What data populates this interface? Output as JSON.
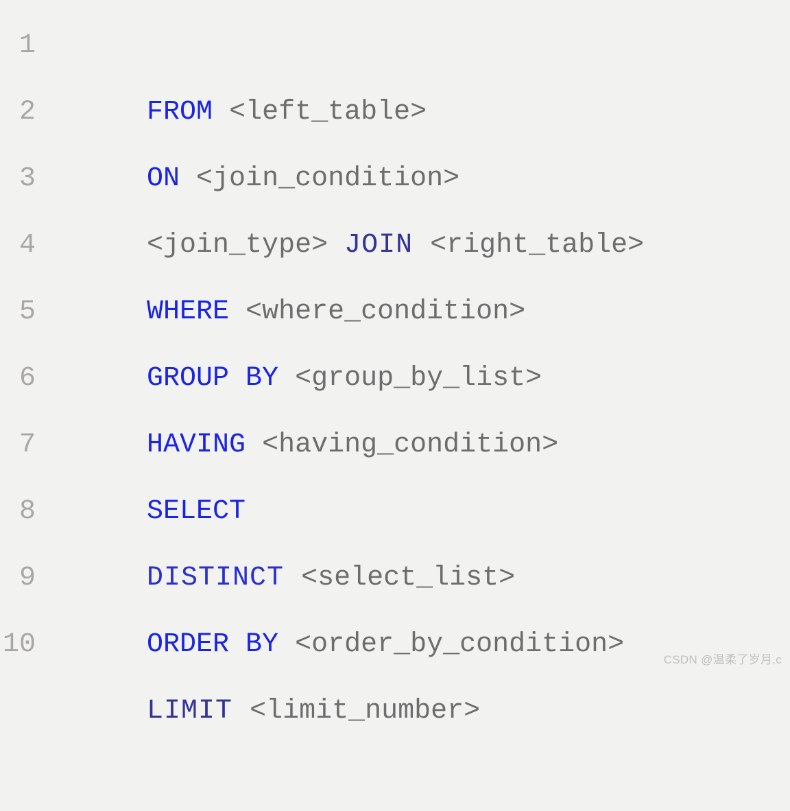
{
  "lines": [
    {
      "num": "1",
      "tokens": [
        {
          "t": "FROM ",
          "c": "keyword"
        },
        {
          "t": "<left_table>",
          "c": "placeholder"
        }
      ]
    },
    {
      "num": "2",
      "tokens": [
        {
          "t": "ON ",
          "c": "keyword"
        },
        {
          "t": "<join_condition>",
          "c": "placeholder"
        }
      ]
    },
    {
      "num": "3",
      "tokens": [
        {
          "t": "<join_type> ",
          "c": "placeholder"
        },
        {
          "t": "JOIN ",
          "c": "keyword2"
        },
        {
          "t": "<right_table>",
          "c": "placeholder"
        }
      ]
    },
    {
      "num": "4",
      "tokens": [
        {
          "t": "WHERE ",
          "c": "keyword"
        },
        {
          "t": "<where_condition>",
          "c": "placeholder"
        }
      ]
    },
    {
      "num": "5",
      "tokens": [
        {
          "t": "GROUP BY ",
          "c": "keyword"
        },
        {
          "t": "<group_by_list>",
          "c": "placeholder"
        }
      ]
    },
    {
      "num": "6",
      "tokens": [
        {
          "t": "HAVING ",
          "c": "keyword"
        },
        {
          "t": "<having_condition>",
          "c": "placeholder"
        }
      ]
    },
    {
      "num": "7",
      "tokens": [
        {
          "t": "SELECT",
          "c": "keyword"
        }
      ]
    },
    {
      "num": "8",
      "tokens": [
        {
          "t": "DISTINCT ",
          "c": "distinct-kw"
        },
        {
          "t": "<select_list>",
          "c": "placeholder"
        }
      ]
    },
    {
      "num": "9",
      "tokens": [
        {
          "t": "ORDER BY ",
          "c": "keyword"
        },
        {
          "t": "<order_by_condition>",
          "c": "placeholder"
        }
      ]
    },
    {
      "num": "10",
      "tokens": [
        {
          "t": "LIMIT ",
          "c": "keyword2"
        },
        {
          "t": "<limit_number>",
          "c": "placeholder"
        }
      ]
    }
  ],
  "watermark": "CSDN @温柔了岁月.c"
}
